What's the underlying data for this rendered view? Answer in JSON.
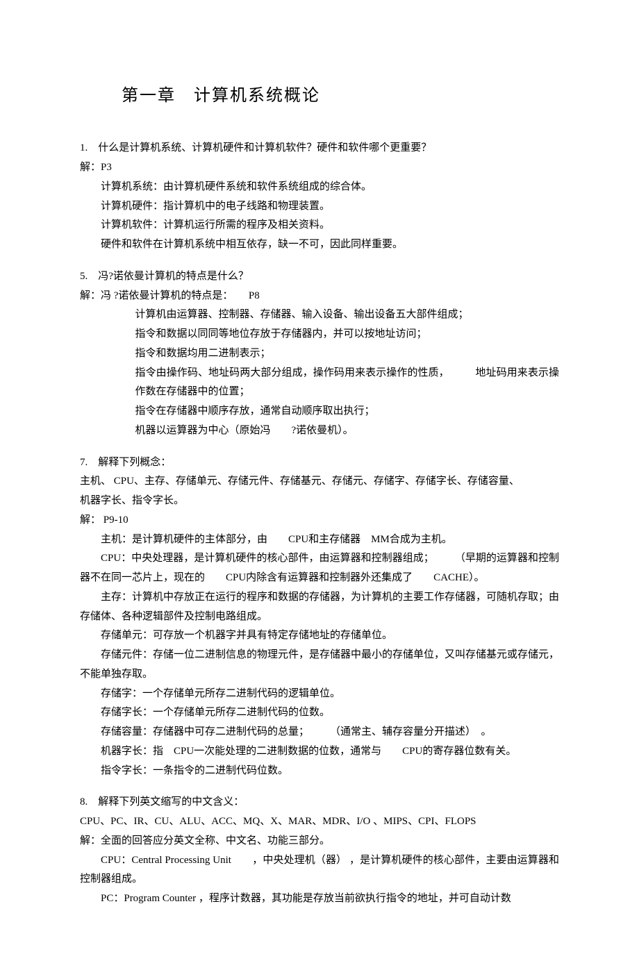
{
  "chapter_title": "第一章　计算机系统概论",
  "q1": {
    "question": "1.　什么是计算机系统、计算机硬件和计算机软件？硬件和软件哪个更重要？",
    "answer_label": "解：P3",
    "lines": [
      "计算机系统：由计算机硬件系统和软件系统组成的综合体。",
      "计算机硬件：指计算机中的电子线路和物理装置。",
      "计算机软件：计算机运行所需的程序及相关资料。",
      "硬件和软件在计算机系统中相互依存，缺一不可，因此同样重要。"
    ]
  },
  "q5": {
    "question": "5.　冯?诺依曼计算机的特点是什么？",
    "answer_label": "解：冯 ?诺依曼计算机的特点是：　　P8",
    "lines": [
      "计算机由运算器、控制器、存储器、输入设备、输出设备五大部件组成；",
      "指令和数据以同同等地位存放于存储器内，并可以按地址访问；",
      "指令和数据均用二进制表示；",
      "指令由操作码、地址码两大部分组成，操作码用来表示操作的性质，　　　地址码用来表示操作数在存储器中的位置；",
      "指令在存储器中顺序存放，通常自动顺序取出执行；",
      "机器以运算器为中心（原始冯　　?诺依曼机）。"
    ]
  },
  "q7": {
    "question": "7.　解释下列概念：",
    "terms_line1": "主机、 CPU、主存、存储单元、存储元件、存储基元、存储元、存储字、存储字长、存储容量、",
    "terms_line2": "机器字长、指令字长。",
    "answer_label": "解： P9-10",
    "defs": [
      "主机：是计算机硬件的主体部分，由　　CPU和主存储器　MM合成为主机。",
      "CPU：中央处理器，是计算机硬件的核心部件，由运算器和控制器组成；　　　（早期的运算器和控制器不在同一芯片上，现在的　　CPU内除含有运算器和控制器外还集成了　　CACHE）。",
      "主存：计算机中存放正在运行的程序和数据的存储器，为计算机的主要工作存储器，可随机存取；由存储体、各种逻辑部件及控制电路组成。",
      "存储单元：可存放一个机器字并具有特定存储地址的存储单位。",
      "存储元件：存储一位二进制信息的物理元件，是存储器中最小的存储单位，又叫存储基元或存储元，不能单独存取。",
      "存储字：一个存储单元所存二进制代码的逻辑单位。",
      "存储字长：一个存储单元所存二进制代码的位数。",
      "存储容量：存储器中可存二进制代码的总量；　　　（通常主、辅存容量分开描述）　。",
      "机器字长：指　CPU一次能处理的二进制数据的位数，通常与　　CPU的寄存器位数有关。",
      "指令字长：一条指令的二进制代码位数。"
    ]
  },
  "q8": {
    "question": "8.　解释下列英文缩写的中文含义：",
    "abbr_line": "CPU、PC、IR、CU、ALU、ACC、MQ、X、MAR、MDR、I/O 、MIPS、CPI、FLOPS",
    "answer_label": "解：全面的回答应分英文全称、中文名、功能三部分。",
    "defs": [
      "CPU：Central Processing Unit　　，中央处理机（器）   ，是计算机硬件的核心部件，主要由运算器和控制器组成。",
      "PC：Program Counter ，程序计数器，其功能是存放当前欲执行指令的地址，并可自动计数"
    ]
  }
}
